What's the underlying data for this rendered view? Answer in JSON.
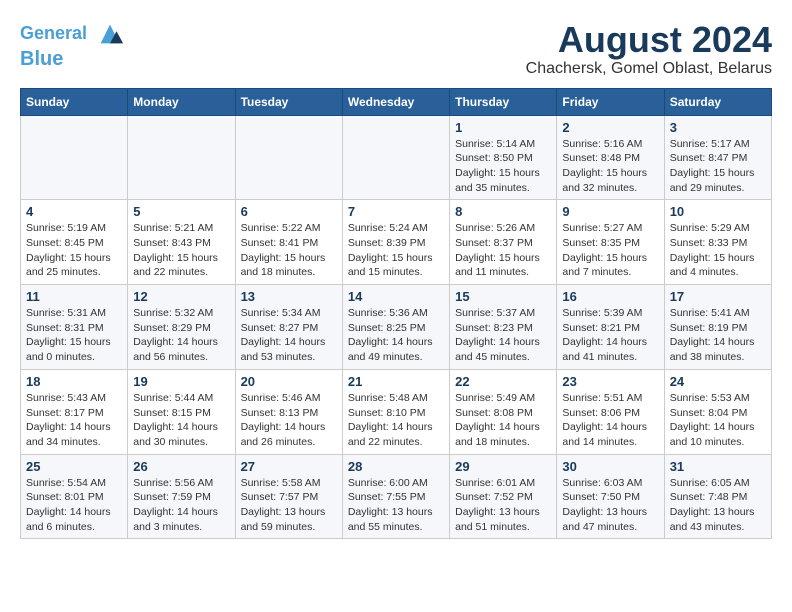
{
  "header": {
    "logo_line1": "General",
    "logo_line2": "Blue",
    "title": "August 2024",
    "subtitle": "Chachersk, Gomel Oblast, Belarus"
  },
  "days_of_week": [
    "Sunday",
    "Monday",
    "Tuesday",
    "Wednesday",
    "Thursday",
    "Friday",
    "Saturday"
  ],
  "weeks": [
    [
      {
        "day": "",
        "info": ""
      },
      {
        "day": "",
        "info": ""
      },
      {
        "day": "",
        "info": ""
      },
      {
        "day": "",
        "info": ""
      },
      {
        "day": "1",
        "info": "Sunrise: 5:14 AM\nSunset: 8:50 PM\nDaylight: 15 hours\nand 35 minutes."
      },
      {
        "day": "2",
        "info": "Sunrise: 5:16 AM\nSunset: 8:48 PM\nDaylight: 15 hours\nand 32 minutes."
      },
      {
        "day": "3",
        "info": "Sunrise: 5:17 AM\nSunset: 8:47 PM\nDaylight: 15 hours\nand 29 minutes."
      }
    ],
    [
      {
        "day": "4",
        "info": "Sunrise: 5:19 AM\nSunset: 8:45 PM\nDaylight: 15 hours\nand 25 minutes."
      },
      {
        "day": "5",
        "info": "Sunrise: 5:21 AM\nSunset: 8:43 PM\nDaylight: 15 hours\nand 22 minutes."
      },
      {
        "day": "6",
        "info": "Sunrise: 5:22 AM\nSunset: 8:41 PM\nDaylight: 15 hours\nand 18 minutes."
      },
      {
        "day": "7",
        "info": "Sunrise: 5:24 AM\nSunset: 8:39 PM\nDaylight: 15 hours\nand 15 minutes."
      },
      {
        "day": "8",
        "info": "Sunrise: 5:26 AM\nSunset: 8:37 PM\nDaylight: 15 hours\nand 11 minutes."
      },
      {
        "day": "9",
        "info": "Sunrise: 5:27 AM\nSunset: 8:35 PM\nDaylight: 15 hours\nand 7 minutes."
      },
      {
        "day": "10",
        "info": "Sunrise: 5:29 AM\nSunset: 8:33 PM\nDaylight: 15 hours\nand 4 minutes."
      }
    ],
    [
      {
        "day": "11",
        "info": "Sunrise: 5:31 AM\nSunset: 8:31 PM\nDaylight: 15 hours\nand 0 minutes."
      },
      {
        "day": "12",
        "info": "Sunrise: 5:32 AM\nSunset: 8:29 PM\nDaylight: 14 hours\nand 56 minutes."
      },
      {
        "day": "13",
        "info": "Sunrise: 5:34 AM\nSunset: 8:27 PM\nDaylight: 14 hours\nand 53 minutes."
      },
      {
        "day": "14",
        "info": "Sunrise: 5:36 AM\nSunset: 8:25 PM\nDaylight: 14 hours\nand 49 minutes."
      },
      {
        "day": "15",
        "info": "Sunrise: 5:37 AM\nSunset: 8:23 PM\nDaylight: 14 hours\nand 45 minutes."
      },
      {
        "day": "16",
        "info": "Sunrise: 5:39 AM\nSunset: 8:21 PM\nDaylight: 14 hours\nand 41 minutes."
      },
      {
        "day": "17",
        "info": "Sunrise: 5:41 AM\nSunset: 8:19 PM\nDaylight: 14 hours\nand 38 minutes."
      }
    ],
    [
      {
        "day": "18",
        "info": "Sunrise: 5:43 AM\nSunset: 8:17 PM\nDaylight: 14 hours\nand 34 minutes."
      },
      {
        "day": "19",
        "info": "Sunrise: 5:44 AM\nSunset: 8:15 PM\nDaylight: 14 hours\nand 30 minutes."
      },
      {
        "day": "20",
        "info": "Sunrise: 5:46 AM\nSunset: 8:13 PM\nDaylight: 14 hours\nand 26 minutes."
      },
      {
        "day": "21",
        "info": "Sunrise: 5:48 AM\nSunset: 8:10 PM\nDaylight: 14 hours\nand 22 minutes."
      },
      {
        "day": "22",
        "info": "Sunrise: 5:49 AM\nSunset: 8:08 PM\nDaylight: 14 hours\nand 18 minutes."
      },
      {
        "day": "23",
        "info": "Sunrise: 5:51 AM\nSunset: 8:06 PM\nDaylight: 14 hours\nand 14 minutes."
      },
      {
        "day": "24",
        "info": "Sunrise: 5:53 AM\nSunset: 8:04 PM\nDaylight: 14 hours\nand 10 minutes."
      }
    ],
    [
      {
        "day": "25",
        "info": "Sunrise: 5:54 AM\nSunset: 8:01 PM\nDaylight: 14 hours\nand 6 minutes."
      },
      {
        "day": "26",
        "info": "Sunrise: 5:56 AM\nSunset: 7:59 PM\nDaylight: 14 hours\nand 3 minutes."
      },
      {
        "day": "27",
        "info": "Sunrise: 5:58 AM\nSunset: 7:57 PM\nDaylight: 13 hours\nand 59 minutes."
      },
      {
        "day": "28",
        "info": "Sunrise: 6:00 AM\nSunset: 7:55 PM\nDaylight: 13 hours\nand 55 minutes."
      },
      {
        "day": "29",
        "info": "Sunrise: 6:01 AM\nSunset: 7:52 PM\nDaylight: 13 hours\nand 51 minutes."
      },
      {
        "day": "30",
        "info": "Sunrise: 6:03 AM\nSunset: 7:50 PM\nDaylight: 13 hours\nand 47 minutes."
      },
      {
        "day": "31",
        "info": "Sunrise: 6:05 AM\nSunset: 7:48 PM\nDaylight: 13 hours\nand 43 minutes."
      }
    ]
  ]
}
